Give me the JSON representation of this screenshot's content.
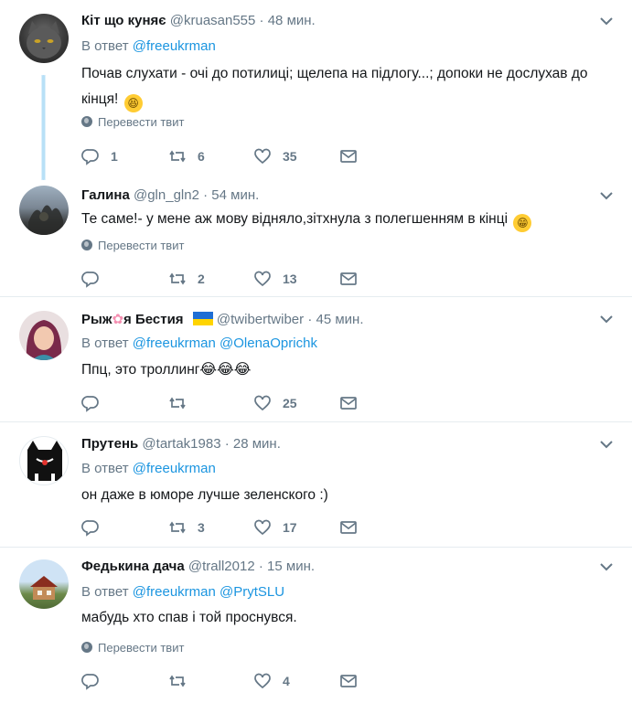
{
  "labels": {
    "reply_prefix": "В ответ",
    "translate": "Перевести твит"
  },
  "tweets": [
    {
      "name": "Кіт що куняє",
      "handle": "@kruasan555",
      "sep": "·",
      "time": "48 мин.",
      "mentions": [
        "@freeukrman"
      ],
      "text": "Почав слухати - очі до потилиці; щелепа на підлогу...; допоки не дослухав до кінця!",
      "emoji": "😆",
      "translate": true,
      "counts": {
        "replies": "1",
        "retweets": "6",
        "likes": "35"
      }
    },
    {
      "name": "Галина",
      "handle": "@gln_gln2",
      "sep": "·",
      "time": "54 мин.",
      "mentions": [],
      "text": "Те саме!- у мене аж мову відняло,зітхнула з полегшенням в кінці",
      "emoji": "😁",
      "translate": true,
      "counts": {
        "replies": "",
        "retweets": "2",
        "likes": "13"
      }
    },
    {
      "name_a": "Рыж",
      "name_b": "я Бестия",
      "handle": "@twibertwiber",
      "sep": "·",
      "time": "45 мин.",
      "mentions": [
        "@freeukrman",
        "@OlenaOprichk"
      ],
      "text": "Ппц, это троллинг",
      "emoji": "😂😂😂",
      "translate": false,
      "counts": {
        "replies": "",
        "retweets": "",
        "likes": "25"
      }
    },
    {
      "name": "Прутень",
      "handle": "@tartak1983",
      "sep": "·",
      "time": "28 мин.",
      "mentions": [
        "@freeukrman"
      ],
      "text": "он даже в юморе лучше зеленского :)",
      "translate": false,
      "counts": {
        "replies": "",
        "retweets": "3",
        "likes": "17"
      }
    },
    {
      "name": "Федькина дача",
      "handle": "@trall2012",
      "sep": "·",
      "time": "15 мин.",
      "mentions": [
        "@freeukrman",
        "@PrytSLU"
      ],
      "text": "мабудь хто спав і той проснувся.",
      "translate": true,
      "counts": {
        "replies": "",
        "retweets": "",
        "likes": "4"
      }
    }
  ],
  "colors": {
    "accent": "#1b95e0",
    "muted": "#657786",
    "text": "#14171a",
    "thread": "#b8e0f7"
  }
}
